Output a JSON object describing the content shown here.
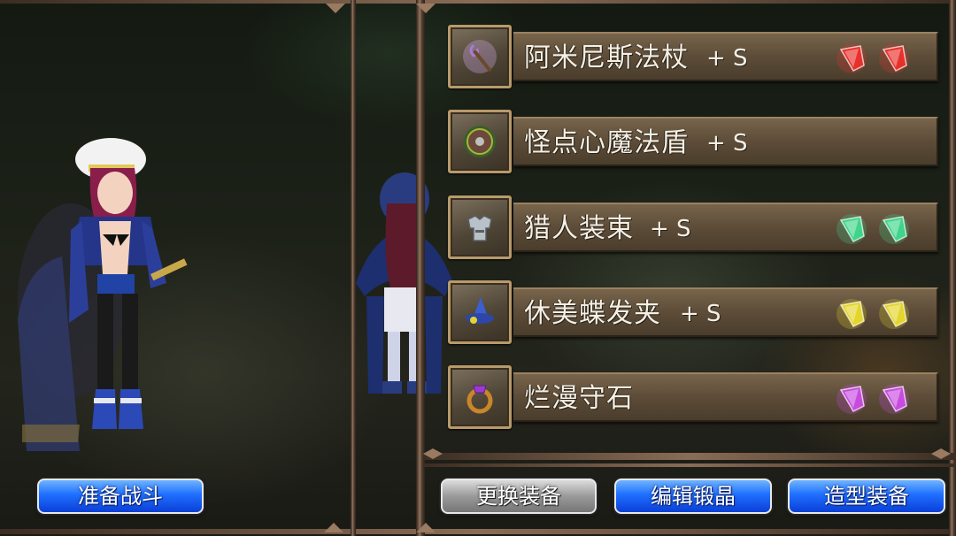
{
  "equipment": [
    {
      "name": "阿米尼斯法杖",
      "refine": "+ S",
      "icon": "staff-icon",
      "gems": [
        "red",
        "red"
      ]
    },
    {
      "name": "怪点心魔法盾",
      "refine": "+ S",
      "icon": "shield-icon",
      "gems": []
    },
    {
      "name": "猎人装束",
      "refine": "+ S",
      "icon": "armor-icon",
      "gems": [
        "green",
        "green"
      ]
    },
    {
      "name": "休美蝶发夹",
      "refine": "+ S",
      "icon": "hat-icon",
      "gems": [
        "yellow",
        "yellow"
      ]
    },
    {
      "name": "烂漫守石",
      "refine": "",
      "icon": "ring-icon",
      "gems": [
        "purple",
        "purple"
      ]
    }
  ],
  "gem_colors": {
    "red": "#e8302a",
    "green": "#3fd48a",
    "yellow": "#e3d52a",
    "purple": "#c84be0"
  },
  "buttons": {
    "prepare_battle": "准备战斗",
    "change_equipment": "更换装备",
    "edit_crystal": "编辑锻晶",
    "style_equipment": "造型装备"
  },
  "colors": {
    "button_blue": "#1f6fff",
    "button_gray": "#9a9a9a",
    "plate_brown": "#5c4c38",
    "frame_bronze": "#8a6c56"
  }
}
